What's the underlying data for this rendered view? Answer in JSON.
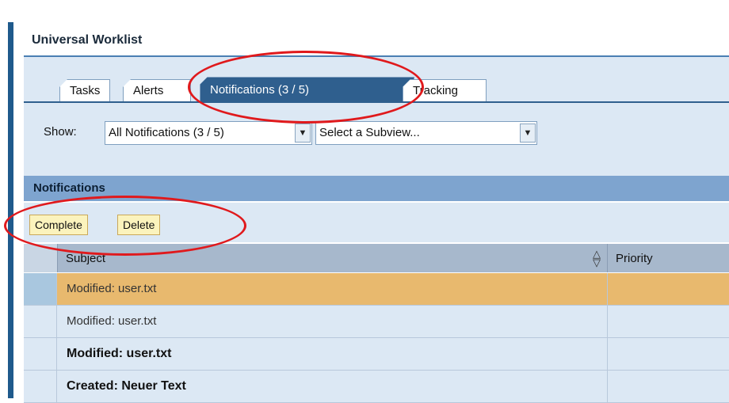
{
  "window": {
    "title": "Universal Worklist"
  },
  "tabs": [
    {
      "label": "Tasks"
    },
    {
      "label": "Alerts"
    },
    {
      "label": "Notifications  (3 / 5)"
    },
    {
      "label": "Tracking"
    }
  ],
  "filters": {
    "show_label": "Show:",
    "view_select": "All Notifications  (3 / 5)",
    "subview_select": "Select a Subview..."
  },
  "section": {
    "title": "Notifications"
  },
  "actions": {
    "complete": "Complete",
    "delete": "Delete"
  },
  "table": {
    "columns": [
      "Subject",
      "Priority"
    ],
    "rows": [
      {
        "subject": "Modified: user.txt",
        "priority": ""
      },
      {
        "subject": "Modified: user.txt",
        "priority": ""
      },
      {
        "subject": "Modified: user.txt",
        "priority": ""
      },
      {
        "subject": "Created: Neuer Text",
        "priority": ""
      }
    ]
  },
  "colors": {
    "brand": "#1f5a8c",
    "active_tab": "#2f5f8e",
    "selected_row": "#e8b96e",
    "highlight_annotation": "#e0191c"
  }
}
